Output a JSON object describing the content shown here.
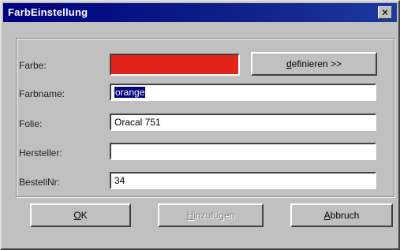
{
  "window": {
    "title": "FarbEinstellung",
    "close_glyph": "✕"
  },
  "labels": {
    "farbe": "Farbe:",
    "farbname": "Farbname:",
    "folie": "Folie:",
    "hersteller": "Hersteller:",
    "bestellnr": "BestellNr:"
  },
  "fields": {
    "farbname": "orange",
    "folie": "Oracal 751",
    "hersteller": "",
    "bestellnr": "34"
  },
  "color_swatch": "#e2231a",
  "buttons": {
    "definieren_key": "d",
    "definieren_rest": "efinieren  >>",
    "ok_key": "O",
    "ok_rest": "K",
    "hinzufuegen_key": "H",
    "hinzufuegen_rest": "inzufügen",
    "abbruch_key": "A",
    "abbruch_rest": "bbruch"
  }
}
